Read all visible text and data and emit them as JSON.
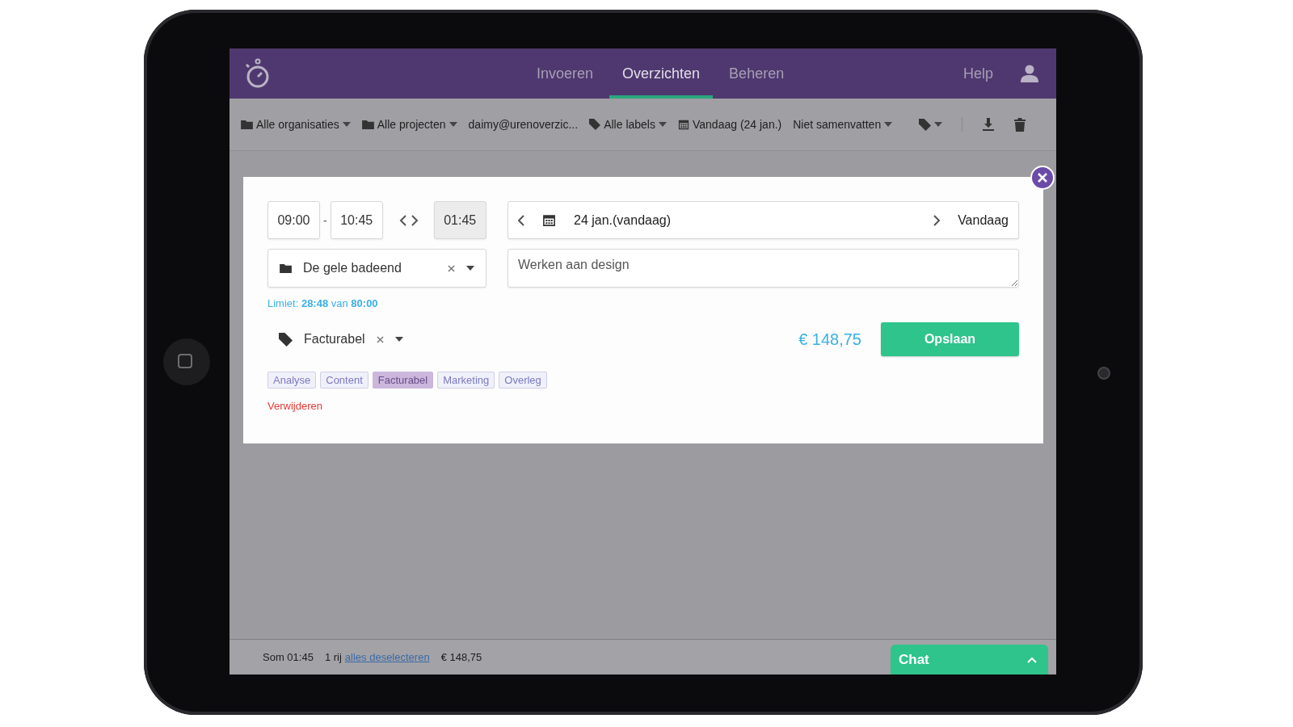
{
  "header": {
    "tabs": [
      {
        "label": "Invoeren",
        "selected": false
      },
      {
        "label": "Overzichten",
        "selected": true
      },
      {
        "label": "Beheren",
        "selected": false
      }
    ],
    "help": "Help"
  },
  "toolbar": {
    "filters": [
      {
        "kind": "folder",
        "label": "Alle organisaties",
        "dropdown": true
      },
      {
        "kind": "folder",
        "label": "Alle projecten",
        "dropdown": true
      },
      {
        "kind": "plain",
        "label": "daimy@urenoverzic...",
        "dropdown": false
      },
      {
        "kind": "tag",
        "label": "Alle labels",
        "dropdown": true
      },
      {
        "kind": "calendar",
        "label": "Vandaag (24 jan.)",
        "dropdown": false
      },
      {
        "kind": "plain",
        "label": "Niet samenvatten",
        "dropdown": true
      }
    ]
  },
  "modal": {
    "start": "09:00",
    "separator": "-",
    "end": "10:45",
    "duration": "01:45",
    "date": "24 jan.(vandaag)",
    "today_button": "Vandaag",
    "project": "De gele badeend",
    "description": "Werken aan design",
    "limit": "Limiet: **28:48** van **80:00**",
    "label_value": "Facturabel",
    "amount": "€ 148,75",
    "save": "Opslaan",
    "tags": [
      {
        "label": "Analyse",
        "selected": false
      },
      {
        "label": "Content",
        "selected": false
      },
      {
        "label": "Facturabel",
        "selected": true
      },
      {
        "label": "Marketing",
        "selected": false
      },
      {
        "label": "Overleg",
        "selected": false
      }
    ],
    "delete": "Verwijderen"
  },
  "footer": {
    "sum": "Som 01:45",
    "rows": "1 rij",
    "deselect_link": "alles deselecteren",
    "total": "€ 148,75",
    "chat": "Chat"
  }
}
